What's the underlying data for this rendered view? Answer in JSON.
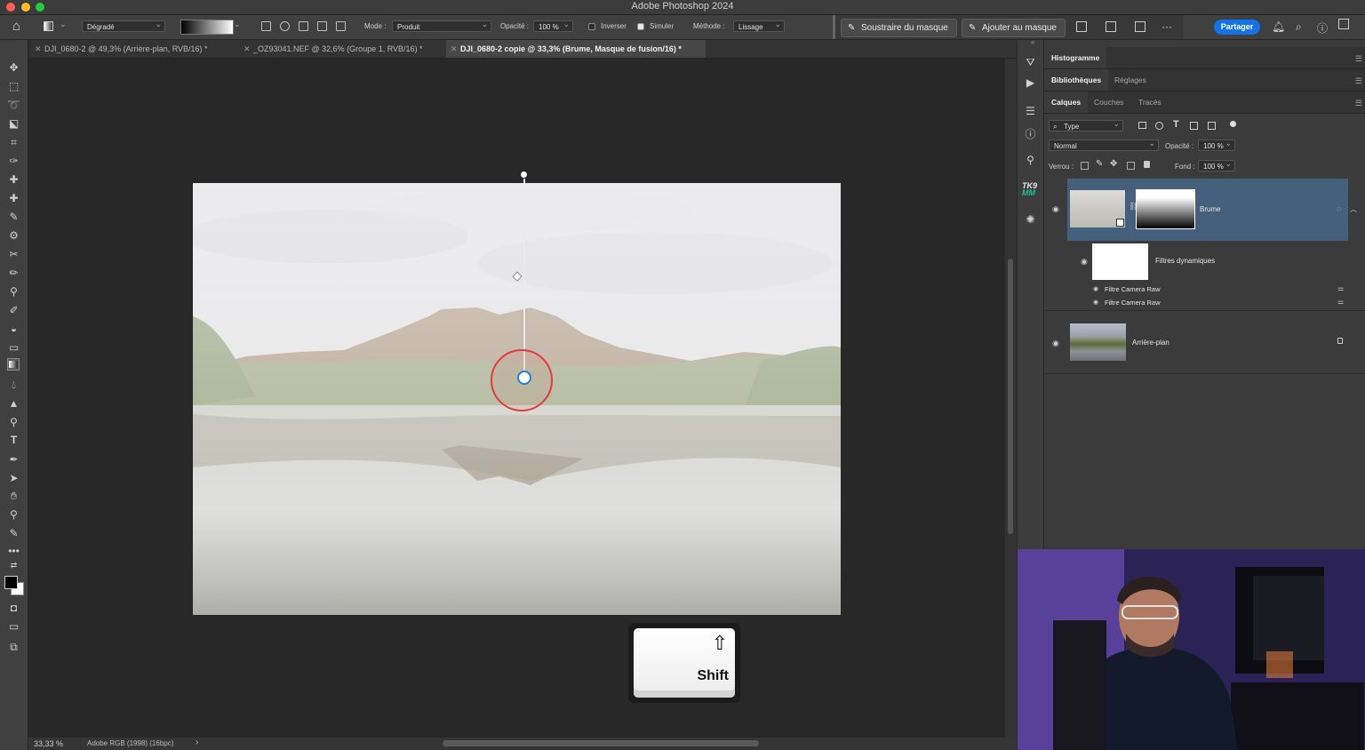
{
  "window": {
    "title": "Adobe Photoshop 2024"
  },
  "options_bar": {
    "gradient_type": "Dégradé",
    "mode_label": "Mode :",
    "mode_value": "Produit",
    "opacity_label": "Opacité :",
    "opacity_value": "100 %",
    "invert_label": "Inverser",
    "simulate_label": "Simuler",
    "method_label": "Méthode :",
    "method_value": "Lissage",
    "subtract_mask": "Soustraire du masque",
    "add_mask": "Ajouter au masque",
    "share": "Partager",
    "more": "···"
  },
  "tabs": [
    {
      "label": "DJI_0680-2 @ 49,3% (Arrière-plan, RVB/16) *"
    },
    {
      "label": "_OZ93041.NEF @ 32,6% (Groupe 1, RVB/16) *"
    },
    {
      "label": "DJI_0680-2 copie @ 33,3% (Brume, Masque de fusion/16) *"
    }
  ],
  "status": {
    "zoom": "33,33 %",
    "profile": "Adobe RGB (1998) (16bpc)",
    "arrow": "›"
  },
  "panels": {
    "histogram": "Histogramme",
    "libraries": "Bibliothèques",
    "adjustments": "Réglages",
    "layers_tab": "Calques",
    "channels_tab": "Couches",
    "paths_tab": "Tracés",
    "filter_kind": "Type",
    "blend_mode": "Normal",
    "opacity_label": "Opacité :",
    "opacity_value": "100 %",
    "lock_label": "Verrou :",
    "fill_label": "Fond :",
    "fill_value": "100 %",
    "layers": [
      {
        "name": "Brume"
      },
      {
        "name": "Filtres dynamiques"
      },
      {
        "name": "Filtre Camera Raw"
      },
      {
        "name": "Filtre Camera Raw"
      },
      {
        "name": "Arrière-plan"
      }
    ]
  },
  "iconstrip": {
    "tk": "TK9",
    "mm": "MM"
  },
  "overlay": {
    "key_label": "Shift",
    "key_symbol": "⇧"
  },
  "colors": {
    "accent": "#1473e6",
    "selected_layer": "#45607c",
    "cursor_ring": "#e23b3b"
  }
}
